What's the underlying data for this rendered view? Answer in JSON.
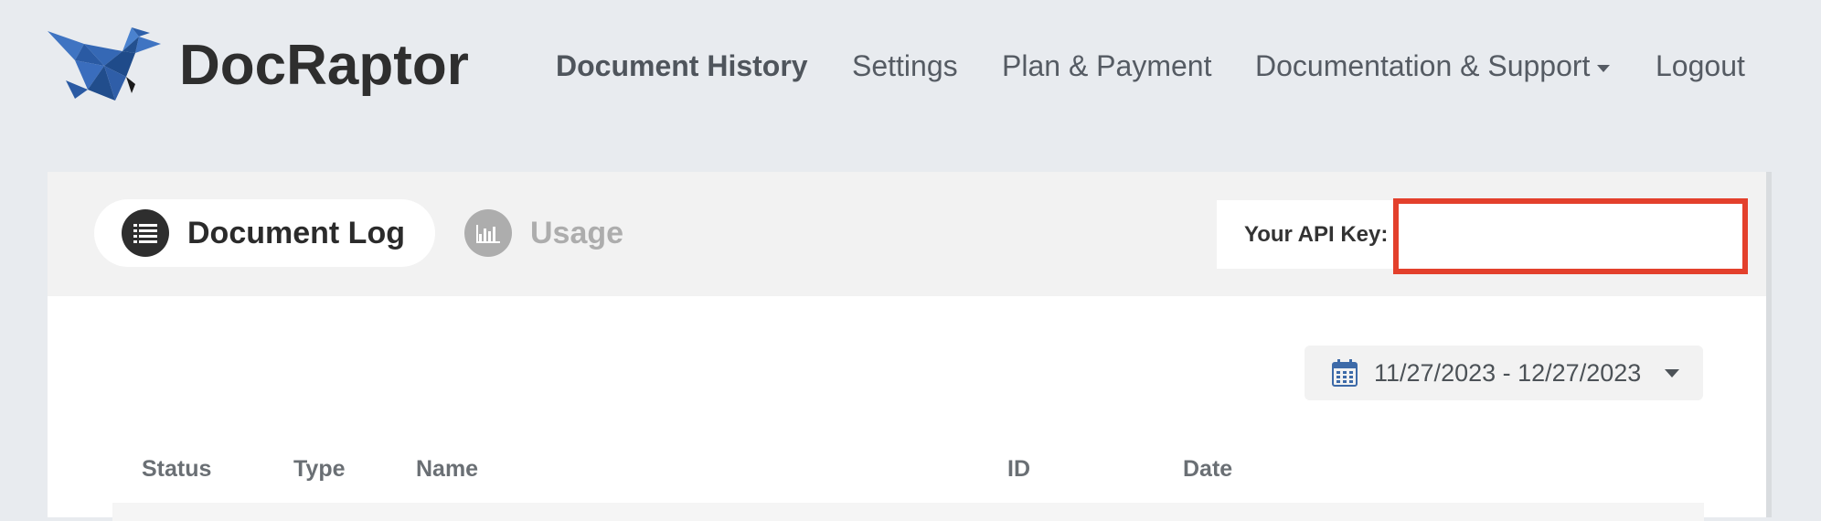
{
  "brand": {
    "name": "DocRaptor"
  },
  "nav": {
    "items": [
      {
        "label": "Document History",
        "active": true
      },
      {
        "label": "Settings"
      },
      {
        "label": "Plan & Payment"
      },
      {
        "label": "Documentation & Support",
        "dropdown": true
      },
      {
        "label": "Logout"
      }
    ]
  },
  "tabs": [
    {
      "label": "Document Log",
      "icon": "list-icon",
      "active": true
    },
    {
      "label": "Usage",
      "icon": "bar-chart-icon",
      "active": false
    }
  ],
  "api_key": {
    "label": "Your API Key:",
    "value": ""
  },
  "date_range": {
    "value": "11/27/2023 - 12/27/2023",
    "icon": "calendar-icon"
  },
  "table": {
    "columns": [
      "Status",
      "Type",
      "Name",
      "ID",
      "Date"
    ]
  },
  "colors": {
    "background": "#e8ebef",
    "logo_blue": "#2f5ea8",
    "highlight_red": "#e3402c",
    "text_dark": "#2e2e2e"
  }
}
